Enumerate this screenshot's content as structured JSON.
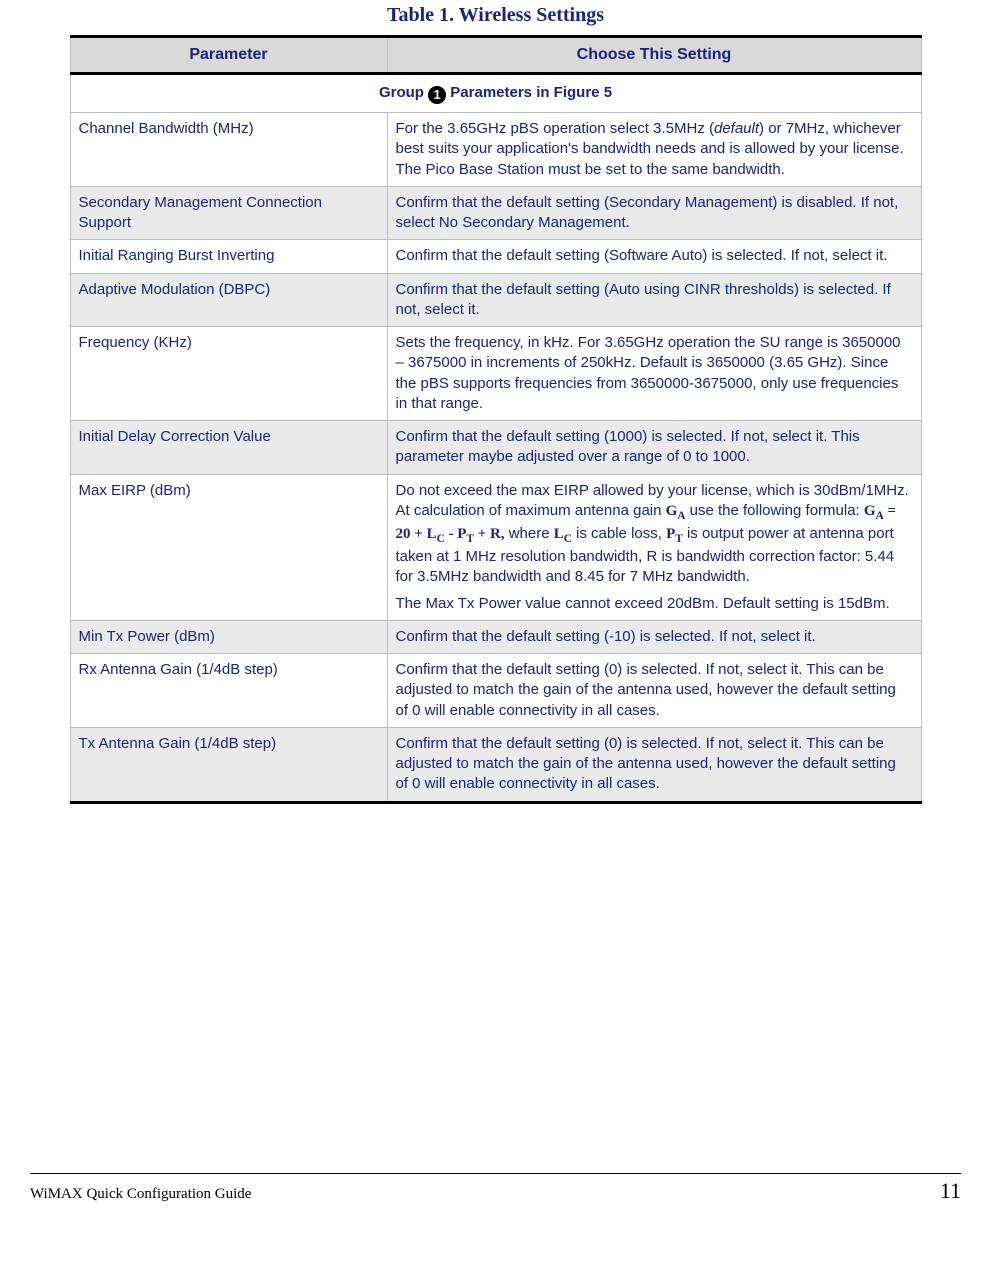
{
  "caption": "Table 1. Wireless Settings",
  "headers": {
    "param": "Parameter",
    "setting": "Choose This Setting"
  },
  "group": {
    "prefix": "Group",
    "num": "1",
    "suffix": " Parameters in Figure 5"
  },
  "rows": [
    {
      "param": "Channel Bandwidth (MHz)",
      "text1": "For the 3.65GHz pBS operation select 3.5MHz (",
      "default_word": "default",
      "text2": ") or 7MHz, whichever best suits your application's bandwidth needs and is allowed by your license. The Pico Base Station must be set to the same bandwidth."
    },
    {
      "param": "Secondary Management Connection Support",
      "text": "Confirm that the default setting (Secondary Management) is disabled. If not, select No Secondary Management."
    },
    {
      "param": "Initial Ranging Burst Inverting",
      "text": "Confirm that the default setting (Software Auto) is selected. If not, select it."
    },
    {
      "param": "Adaptive Modulation (DBPC)",
      "text": "Confirm that the default setting (Auto using CINR thresholds) is selected. If not, select it."
    },
    {
      "param": "Frequency (KHz)",
      "text": "Sets the frequency, in kHz. For 3.65GHz operation the SU range is 3650000 – 3675000 in increments of 250kHz. Default is 3650000 (3.65 GHz). Since the pBS supports frequencies from 3650000-3675000, only use frequencies in that range."
    },
    {
      "param": "Initial Delay Correction Value",
      "text": "Confirm that the default setting (1000) is selected. If not, select it. This parameter maybe adjusted over a range of 0 to 1000."
    },
    {
      "param": "Max EIRP (dBm)",
      "t1": "Do not exceed the max EIRP allowed by your license, which is 30dBm/1MHz. At calculation of maximum antenna gain ",
      "ga": "G",
      "ga_sub": "A",
      "t2": " use the following formula: ",
      "fGA": "G",
      "fGA_sub": "A",
      "eq": " = 20 + ",
      "fLC": "L",
      "fLC_sub": "C",
      "minus": " - ",
      "fPT": "P",
      "fPT_sub": "T",
      "plusR": " + R,",
      "t3": " where ",
      "lc2": "L",
      "lc2_sub": "C",
      "t4": " is cable loss, ",
      "pt2": "P",
      "pt2_sub": "T",
      "t5": " is output power at antenna port taken at 1 MHz resolution bandwidth, R is bandwidth correction factor: 5.44 for 3.5MHz bandwidth and 8.45 for 7 MHz bandwidth.",
      "p2": "The Max Tx Power value cannot exceed 20dBm. Default setting is 15dBm."
    },
    {
      "param": "Min Tx Power (dBm)",
      "text": "Confirm that the default setting (-10) is selected. If not, select it."
    },
    {
      "param": "Rx Antenna Gain (1/4dB step)",
      "text": "Confirm that the default setting (0) is selected. If not, select it. This can be adjusted to match the gain of the antenna used, however the default setting of 0 will enable connectivity in all cases."
    },
    {
      "param": "Tx Antenna Gain (1/4dB step)",
      "text": "Confirm that the default setting (0) is selected. If not, select it. This can be adjusted to match the gain of the antenna used, however the default setting of 0 will enable connectivity in all cases."
    }
  ],
  "footer": {
    "guide": "WiMAX Quick Configuration Guide",
    "page": "11"
  }
}
